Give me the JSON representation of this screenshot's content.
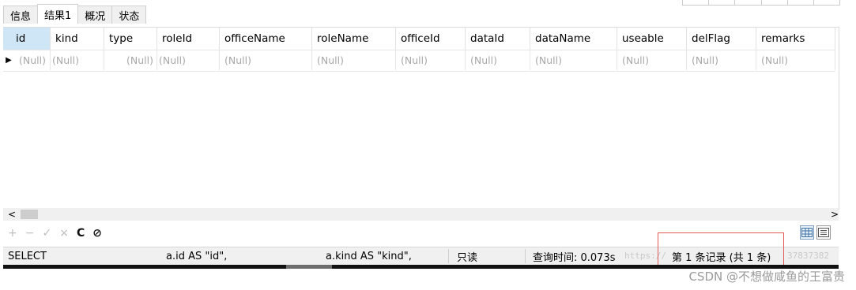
{
  "tabs": [
    "信息",
    "结果1",
    "概况",
    "状态"
  ],
  "active_tab": "结果1",
  "columns": [
    "id",
    "kind",
    "type",
    "roleId",
    "officeName",
    "roleName",
    "officeId",
    "dataId",
    "dataName",
    "useable",
    "delFlag",
    "remarks"
  ],
  "rows": [
    [
      "(Null)",
      "(Null)",
      "(Null)",
      "(Null)",
      "(Null)",
      "(Null)",
      "(Null)",
      "(Null)",
      "(Null)",
      "(Null)",
      "(Null)",
      "(Null)"
    ]
  ],
  "scroll": {
    "left_arrow": "<",
    "right_arrow": ">"
  },
  "toolbar": {
    "add_icon": "plus-icon",
    "delete_icon": "minus-icon",
    "apply_icon": "check-icon",
    "discard_icon": "cross-icon",
    "refresh_icon": "refresh-icon",
    "stop_icon": "stop-icon",
    "plus": "+",
    "minus": "−",
    "check": "✓",
    "cross": "×",
    "refresh": "C",
    "stop": "⊘"
  },
  "status": {
    "query_start": "SELECT",
    "col1": "a.id AS \"id\",",
    "col2": "a.kind AS \"kind\",",
    "mode": "只读",
    "query_time": "查询时间: 0.073s",
    "record": "第 1 条记录 (共 1 条)"
  },
  "watermark": {
    "url": "https://",
    "number": "37837382",
    "credit": "CSDN @不想做咸鱼的王富贵"
  },
  "colors": {
    "header_highlight": "#cfe6f7",
    "null_text": "#a8a8a8",
    "annotation_box": "#e15b5b"
  }
}
